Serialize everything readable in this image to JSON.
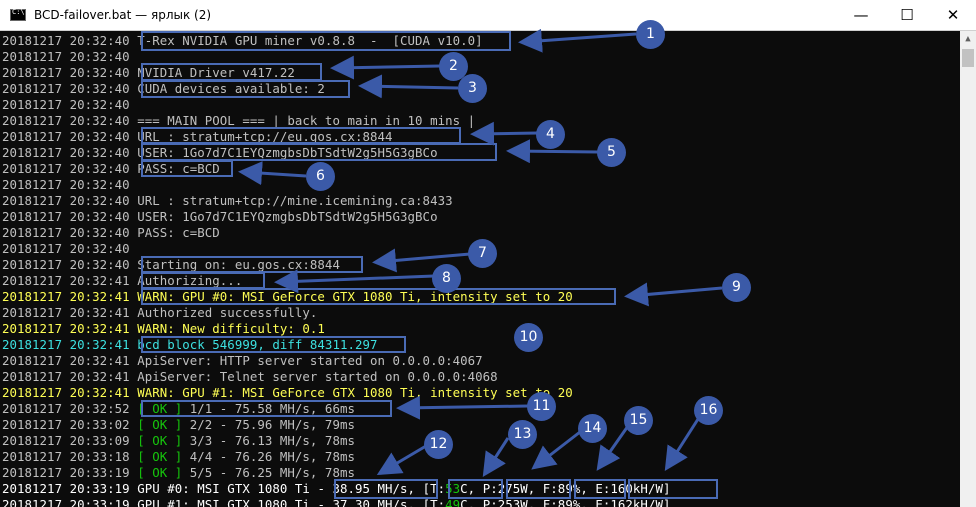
{
  "window": {
    "title": "BCD-failover.bat — ярлык (2)",
    "minimize_glyph": "—",
    "maximize_glyph": "☐",
    "close_glyph": "✕",
    "icon": "cmd-console-icon"
  },
  "console": {
    "lines": [
      {
        "ts": "20181217 20:32:40",
        "text": "T-Rex NVIDIA GPU miner v0.8.8  -  [CUDA v10.0]"
      },
      {
        "ts": "20181217 20:32:40",
        "text": ""
      },
      {
        "ts": "20181217 20:32:40",
        "text": "NVIDIA Driver v417.22"
      },
      {
        "ts": "20181217 20:32:40",
        "text": "CUDA devices available: 2"
      },
      {
        "ts": "20181217 20:32:40",
        "text": ""
      },
      {
        "ts": "20181217 20:32:40",
        "text": "=== MAIN POOL === | back to main in 10 mins |"
      },
      {
        "ts": "20181217 20:32:40",
        "text": "URL : stratum+tcp://eu.gos.cx:8844"
      },
      {
        "ts": "20181217 20:32:40",
        "text": "USER: 1Go7d7C1EYQzmgbsDbTSdtW2g5H5G3gBCo"
      },
      {
        "ts": "20181217 20:32:40",
        "text": "PASS: c=BCD"
      },
      {
        "ts": "20181217 20:32:40",
        "text": ""
      },
      {
        "ts": "20181217 20:32:40",
        "text": "URL : stratum+tcp://mine.icemining.ca:8433"
      },
      {
        "ts": "20181217 20:32:40",
        "text": "USER: 1Go7d7C1EYQzmgbsDbTSdtW2g5H5G3gBCo"
      },
      {
        "ts": "20181217 20:32:40",
        "text": "PASS: c=BCD"
      },
      {
        "ts": "20181217 20:32:40",
        "text": ""
      },
      {
        "ts": "20181217 20:32:40",
        "text": "Starting on: eu.gos.cx:8844"
      },
      {
        "ts": "20181217 20:32:41",
        "text": "Authorizing..."
      },
      {
        "ts": "20181217 20:32:41",
        "text": "WARN: GPU #0: MSI GeForce GTX 1080 Ti, intensity set to 20"
      },
      {
        "ts": "20181217 20:32:41",
        "text": "Authorized successfully."
      },
      {
        "ts": "20181217 20:32:41",
        "text": "WARN: New difficulty: 0.1"
      },
      {
        "ts": "20181217 20:32:41",
        "text": "bcd block 546999, diff 84311.297"
      },
      {
        "ts": "20181217 20:32:41",
        "text": "ApiServer: HTTP server started on 0.0.0.0:4067"
      },
      {
        "ts": "20181217 20:32:41",
        "text": "ApiServer: Telnet server started on 0.0.0.0:4068"
      },
      {
        "ts": "20181217 20:32:41",
        "text": "WARN: GPU #1: MSI GeForce GTX 1080 Ti, intensity set to 20"
      },
      {
        "ts": "20181217 20:32:52",
        "ok": "[ OK ]",
        "text": " 1/1 - 75.58 MH/s, 66ms"
      },
      {
        "ts": "20181217 20:33:02",
        "ok": "[ OK ]",
        "text": " 2/2 - 75.96 MH/s, 79ms"
      },
      {
        "ts": "20181217 20:33:09",
        "ok": "[ OK ]",
        "text": " 3/3 - 76.13 MH/s, 78ms"
      },
      {
        "ts": "20181217 20:33:18",
        "ok": "[ OK ]",
        "text": " 4/4 - 76.26 MH/s, 78ms"
      },
      {
        "ts": "20181217 20:33:19",
        "ok": "[ OK ]",
        "text": " 5/5 - 76.25 MH/s, 78ms"
      },
      {
        "ts": "20181217 20:33:19",
        "pre": "GPU #0: MSI GTX 1080 Ti ",
        "hash": "- 38.95 MH/s,",
        "t1": " [T:",
        "temp": "53",
        "t2": "C,",
        "power": " P:275W,",
        "fan": " F:89%,",
        "eff": " E:160kH/W]"
      },
      {
        "ts": "20181217 20:33:19",
        "pre": "GPU #1: MSI GTX 1080 Ti ",
        "hash": "- 37.30 MH/s,",
        "t1": " [T:",
        "temp": "49",
        "t2": "C,",
        "power": " P:253W,",
        "fan": " F:89%,",
        "eff": " E:162kH/W]"
      }
    ]
  },
  "markers": [
    "1",
    "2",
    "3",
    "4",
    "5",
    "6",
    "7",
    "8",
    "9",
    "10",
    "11",
    "12",
    "13",
    "14",
    "15",
    "16"
  ],
  "colors": {
    "annotation": "#3b5aa8",
    "ok_green": "#16c60c",
    "warn_yellow": "#ffff55",
    "block_cyan": "#3de0e0"
  }
}
